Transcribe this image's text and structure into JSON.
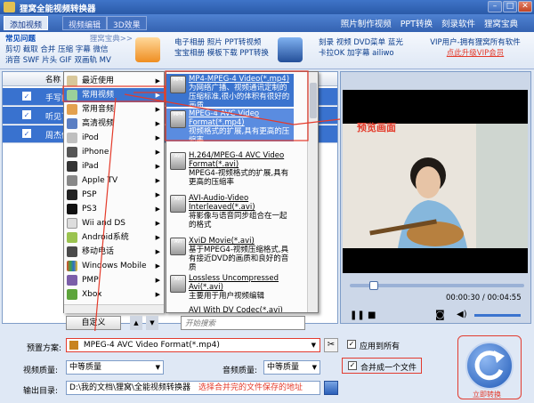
{
  "window": {
    "title": "狸窝全能视频转换器"
  },
  "toolbar": {
    "add_video": "添加视频",
    "btn2": "视频编辑",
    "btn3": "3D效果",
    "links": [
      "照片制作视频",
      "PPT转换",
      "刻录软件",
      "狸窝宝典"
    ]
  },
  "promo": {
    "faq_title": "常见问题",
    "faq_right": "狸窝宝典>>",
    "faq_lines": [
      "剪切 截取 合并 压缩 字幕 微信",
      "消音 SWF 片头 GIF 双画轨 MV"
    ],
    "group1": [
      "电子相册 照片 PPT转视频",
      "宝宝相册 模板下载 PPT转换"
    ],
    "group2": [
      "刻录 视频 DVD菜单 蓝光",
      "卡拉OK 加字幕 ailiwo"
    ],
    "vip": "VIP用户-拥有狸窝所有软件",
    "vip_link": "点此升级VIP会员"
  },
  "list": {
    "header_name": "名称",
    "rows": [
      "手写的",
      "听见下",
      "周杰伦"
    ]
  },
  "menu_main": {
    "items": [
      "最近使用",
      "常用视频",
      "常用音频",
      "高清视频",
      "iPod",
      "iPhone",
      "iPad",
      "Apple TV",
      "PSP",
      "PS3",
      "Wii and DS",
      "Android系统",
      "移动电话",
      "Windows Mobile",
      "PMP",
      "Xbox"
    ],
    "custom_label": "自定义",
    "search_placeholder": "开始搜索"
  },
  "formats": [
    {
      "name": "MP4-MPEG-4 Video(*.mp4)",
      "desc": "为网络广播、视频通讯定制的压缩标准,很小的体积有很好的画质"
    },
    {
      "name": "MPEG-4 AVC Video Format(*.mp4)",
      "desc": "视频格式的扩展,具有更高的压缩率"
    },
    {
      "name": "H.264/MPEG-4 AVC Video Format(*.avi)",
      "desc": "MPEG4-视频格式的扩展,具有更高的压缩率"
    },
    {
      "name": "AVI-Audio-Video Interleaved(*.avi)",
      "desc": "将影像与语音同步组合在一起的格式"
    },
    {
      "name": "XviD Movie(*.avi)",
      "desc": "基于MPEG4-视频压缩格式,具有接近DVD的画质和良好的音质"
    },
    {
      "name": "Lossless Uncompressed Avi(*.avi)",
      "desc": "主要用于用户视频编辑"
    },
    {
      "name": "AVI With DV Codec(*.avi)",
      "desc": ""
    }
  ],
  "annotation": {
    "preview": "预览画面",
    "save_hint": "选择合并完的文件保存的地址"
  },
  "player": {
    "time": "00:00:30 / 00:04:55"
  },
  "settings": {
    "preset_label": "预置方案:",
    "preset_value": "MPEG-4 AVC Video Format(*.mp4)",
    "apply_all": "应用到所有",
    "merge": "合并成一个文件",
    "video_quality_label": "视频质量:",
    "video_quality": "中等质量",
    "audio_quality_label": "音频质量:",
    "audio_quality": "中等质量",
    "output_label": "输出目录:",
    "output_path": "D:\\我的文档\\狸窝\\全能视频转换器"
  },
  "convert": {
    "label": "立即转换"
  },
  "colors": {
    "accent": "#3b74cf",
    "annotation": "#e43a2a"
  }
}
